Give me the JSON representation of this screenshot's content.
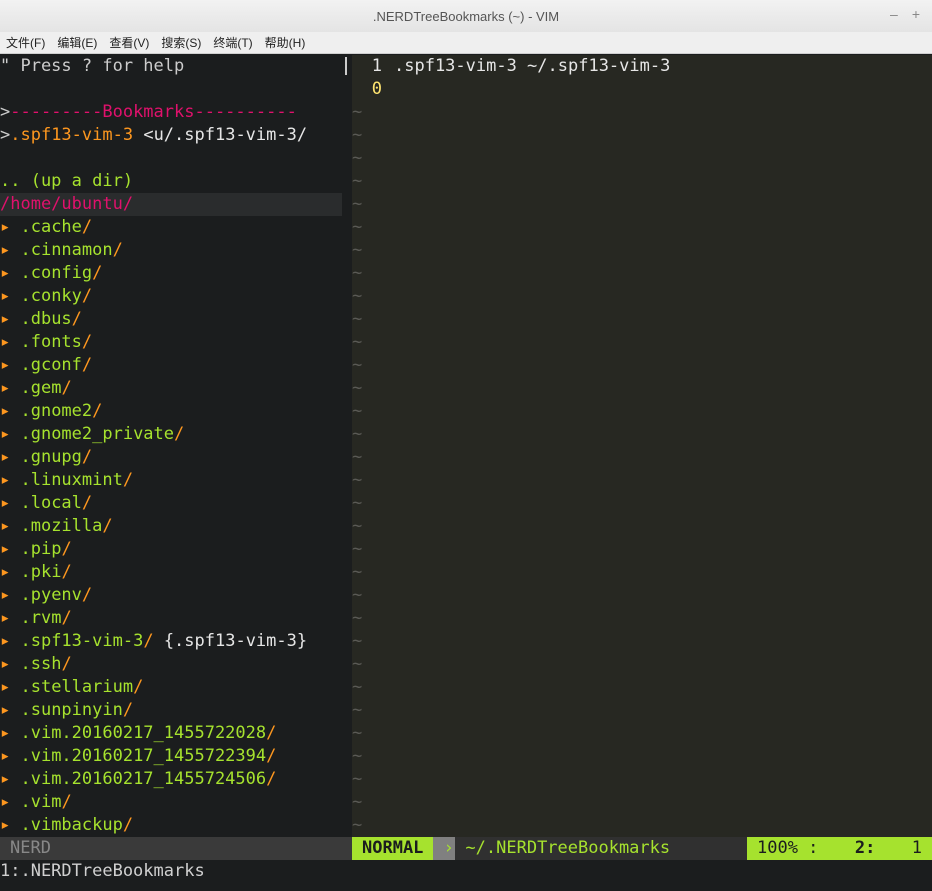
{
  "window": {
    "title": ".NERDTreeBookmarks (~) - VIM",
    "min": "–",
    "max": "+"
  },
  "menu": [
    "文件(F)",
    "编辑(E)",
    "查看(V)",
    "搜索(S)",
    "终端(T)",
    "帮助(H)"
  ],
  "tree": {
    "help": "\" Press ? for help",
    "bookmarks_header": "---------Bookmarks----------",
    "bookmark": {
      "name": ".spf13-vim-3",
      "path": "<u/.spf13-vim-3/"
    },
    "updir": ".. (up a dir)",
    "root": "/home/ubuntu/",
    "dirs": [
      ".cache",
      ".cinnamon",
      ".config",
      ".conky",
      ".dbus",
      ".fonts",
      ".gconf",
      ".gem",
      ".gnome2",
      ".gnome2_private",
      ".gnupg",
      ".linuxmint",
      ".local",
      ".mozilla",
      ".pip",
      ".pki",
      ".pyenv",
      ".rvm",
      ".spf13-vim-3",
      ".ssh",
      ".stellarium",
      ".sunpinyin",
      ".vim.20160217_1455722028",
      ".vim.20160217_1455722394",
      ".vim.20160217_1455724506",
      ".vim",
      ".vimbackup"
    ],
    "spf_link": "{.spf13-vim-3}"
  },
  "editor": {
    "line1_num": "1",
    "line1_text": ".spf13-vim-3 ~/.spf13-vim-3",
    "line2_num": "0",
    "tilde_count": 32
  },
  "status": {
    "left": "NERD",
    "mode": "NORMAL",
    "file": "~/.NERDTreeBookmarks",
    "percent": "100% :",
    "line": "2:",
    "col": "1"
  },
  "cmdline": "1:.NERDTreeBookmarks"
}
